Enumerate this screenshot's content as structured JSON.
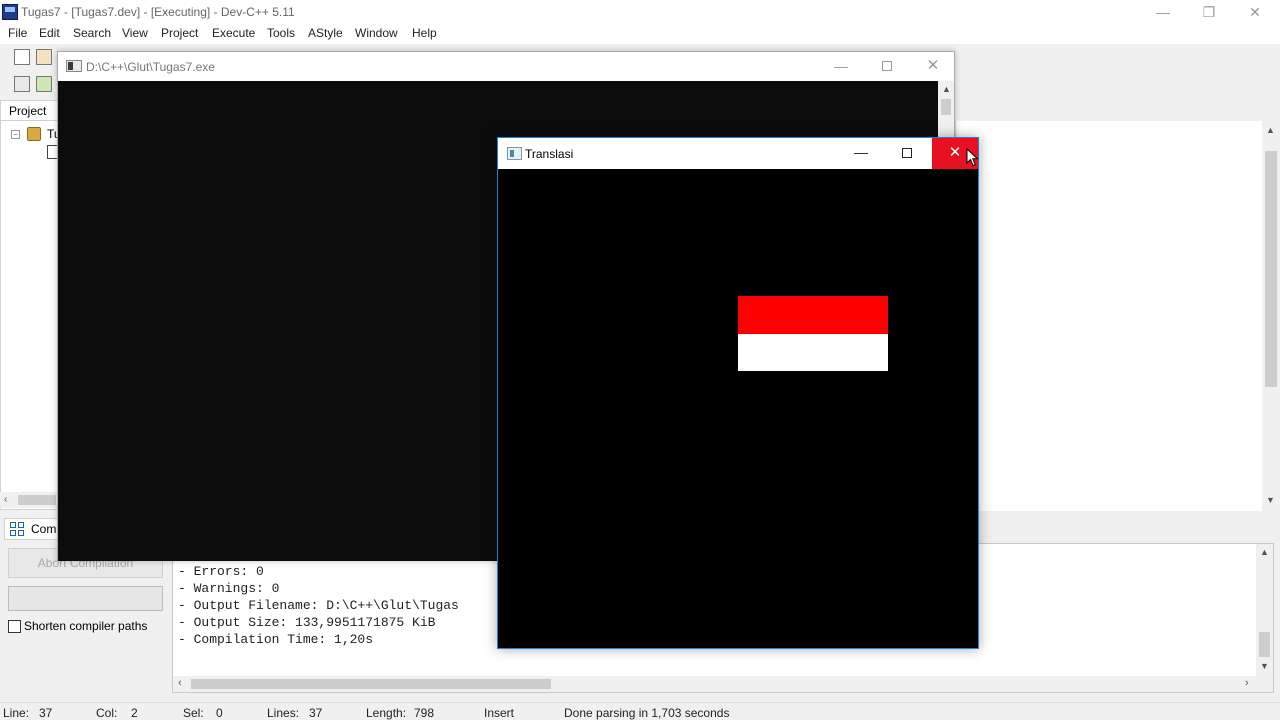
{
  "devcpp": {
    "title": "Tugas7 - [Tugas7.dev] - [Executing] - Dev-C++ 5.11",
    "menu": [
      "File",
      "Edit",
      "Search",
      "View",
      "Project",
      "Execute",
      "Tools",
      "AStyle",
      "Window",
      "Help"
    ],
    "project_tab": "Project",
    "project_tree_item": "Tu",
    "compiler_tab": "Comp",
    "abort_button": "Abort Compilation",
    "shorten_paths_label": "Shorten compiler paths",
    "log_lines": [
      "- Errors: 0",
      "- Warnings: 0",
      "- Output Filename: D:\\C++\\Glut\\Tugas",
      "- Output Size: 133,9951171875 KiB",
      "- Compilation Time: 1,20s"
    ],
    "status": {
      "line_label": "Line:",
      "line_value": "37",
      "col_label": "Col:",
      "col_value": "2",
      "sel_label": "Sel:",
      "sel_value": "0",
      "lines_label": "Lines:",
      "lines_value": "37",
      "length_label": "Length:",
      "length_value": "798",
      "mode": "Insert",
      "message": "Done parsing in 1,703 seconds"
    }
  },
  "console": {
    "title": "D:\\C++\\Glut\\Tugas7.exe"
  },
  "translasi": {
    "title": "Translasi",
    "flag_colors": {
      "top": "#ff0000",
      "bottom": "#ffffff"
    }
  },
  "glyphs": {
    "minimize": "—",
    "maximize": "☐",
    "close": "✕"
  }
}
